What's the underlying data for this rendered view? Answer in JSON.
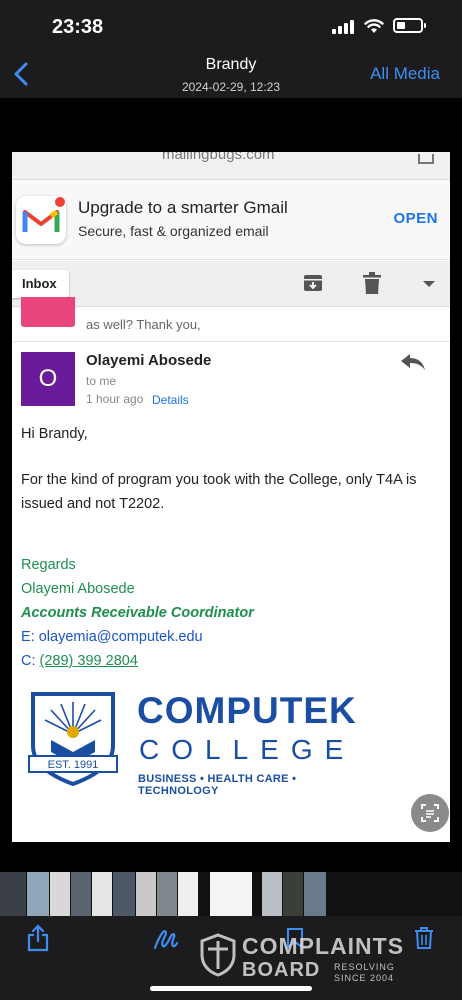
{
  "status_bar": {
    "time": "23:38"
  },
  "nav": {
    "title": "Brandy",
    "subtitle": "2024-02-29, 12:23",
    "right_label": "All Media"
  },
  "url_strip": {
    "text": "mailingbugs.com"
  },
  "gmail_banner": {
    "title": "Upgrade to a smarter Gmail",
    "subtitle": "Secure, fast & organized email",
    "action": "OPEN"
  },
  "toolbar": {
    "inbox_label": "Inbox"
  },
  "previous_message": {
    "snippet": "as well? Thank you,"
  },
  "message": {
    "avatar_letter": "O",
    "sender": "Olayemi Abosede",
    "to": "to me",
    "time": "1 hour ago",
    "details_label": "Details",
    "greeting": "Hi Brandy,",
    "body_line1": "For the kind of program you took with the College, only T4A is",
    "body_line2": "issued and not T2202.",
    "sig_regards": "Regards",
    "sig_name": "Olayemi Abosede",
    "sig_title": "Accounts Receivable Coordinator",
    "sig_email_prefix": "E: ",
    "sig_email": "olayemia@computek.edu",
    "sig_phone_prefix": "C: ",
    "sig_phone": "(289) 399 2804"
  },
  "logo": {
    "main": "COMPUTEK",
    "sub": "COLLEGE",
    "tagline": "BUSINESS • HEALTH CARE • TECHNOLOGY",
    "est": "EST. 1991"
  },
  "watermark": {
    "top": "COMPLAINTS",
    "bottom": "BOARD",
    "tag_line1": "RESOLVING",
    "tag_line2": "SINCE 2004"
  },
  "colors": {
    "ios_blue": "#3d8ef0",
    "gmail_blue": "#1a73e8",
    "signature_green": "#1e8f4e",
    "avatar_purple": "#6a1b9a",
    "logo_blue": "#1a4ea3"
  },
  "icons": [
    "back-chevron-icon",
    "gmail-logo-icon",
    "archive-icon",
    "trash-icon",
    "more-icon",
    "reply-icon",
    "scan-text-icon",
    "share-icon",
    "markup-icon",
    "crop-icon",
    "delete-icon"
  ]
}
